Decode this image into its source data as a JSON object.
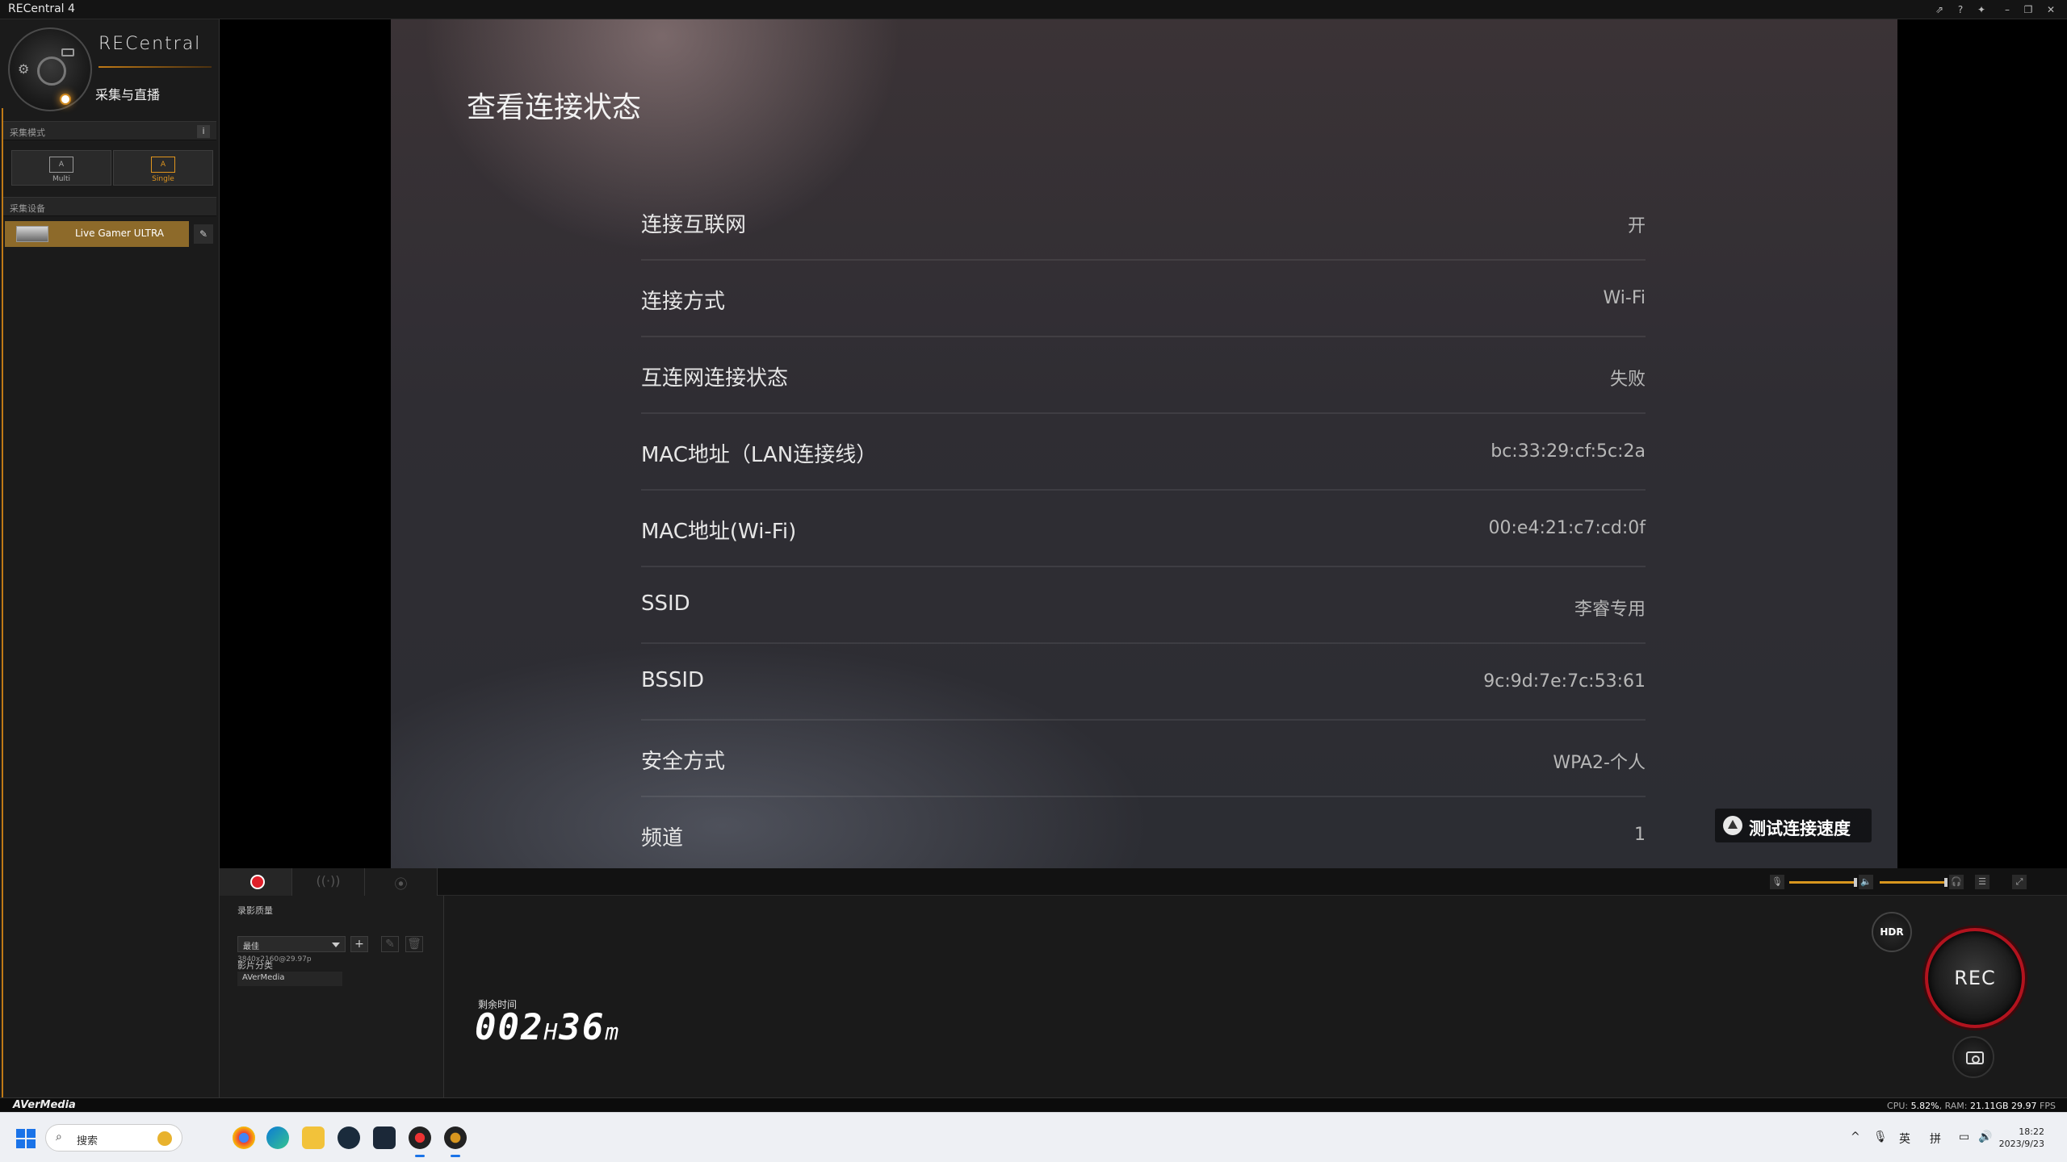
{
  "window": {
    "title": "RECentral 4"
  },
  "sidebar": {
    "brand": "RECentral",
    "mode_name": "采集与直播",
    "capture_mode_header": "采集模式",
    "modes": [
      {
        "label": "Multi",
        "glyph": "A"
      },
      {
        "label": "Single",
        "glyph": "A"
      }
    ],
    "active_mode": "Single",
    "device_header": "采集设备",
    "device_name": "Live Gamer ULTRA"
  },
  "video": {
    "title": "查看连接状态",
    "rows": [
      {
        "key": "连接互联网",
        "value": "开"
      },
      {
        "key": "连接方式",
        "value": "Wi-Fi"
      },
      {
        "key": "互连网连接状态",
        "value": "失败"
      },
      {
        "key": "MAC地址（LAN连接线）",
        "value": "bc:33:29:cf:5c:2a"
      },
      {
        "key": "MAC地址(Wi-Fi)",
        "value": "00:e4:21:c7:cd:0f"
      },
      {
        "key": "SSID",
        "value": "李睿专用"
      },
      {
        "key": "BSSID",
        "value": "9c:9d:7e:7c:53:61"
      },
      {
        "key": "安全方式",
        "value": "WPA2-个人"
      },
      {
        "key": "频道",
        "value": "1"
      }
    ],
    "speed_test_label": "测试连接速度"
  },
  "controls": {
    "quality_label": "录影质量",
    "quality_value": "最佳",
    "resolution": "3840x2160@29.97p",
    "category_label": "影片分类",
    "folder_value": "AVerMedia",
    "remaining_label": "剩余时间",
    "remaining_hours": "002",
    "remaining_h_unit": "H",
    "remaining_minutes": "36",
    "remaining_m_unit": "m",
    "hdr_label": "HDR",
    "rec_label": "REC",
    "mic_volume_level": 0.95,
    "speaker_volume_level": 0.95
  },
  "status": {
    "brand": "AVerMedia",
    "cpu_label": "CPU:",
    "cpu_value": "5.82%",
    "ram_label": "RAM:",
    "ram_value": "21.11GB",
    "fps_value": "29.97",
    "fps_label": "FPS"
  },
  "taskbar": {
    "search_placeholder": "搜索",
    "lang": "英",
    "ime": "拼",
    "time": "18:22",
    "date": "2023/9/23"
  },
  "colors": {
    "accent": "#d8961e",
    "record": "#e0202a",
    "device_bg": "#8d6a2a"
  }
}
